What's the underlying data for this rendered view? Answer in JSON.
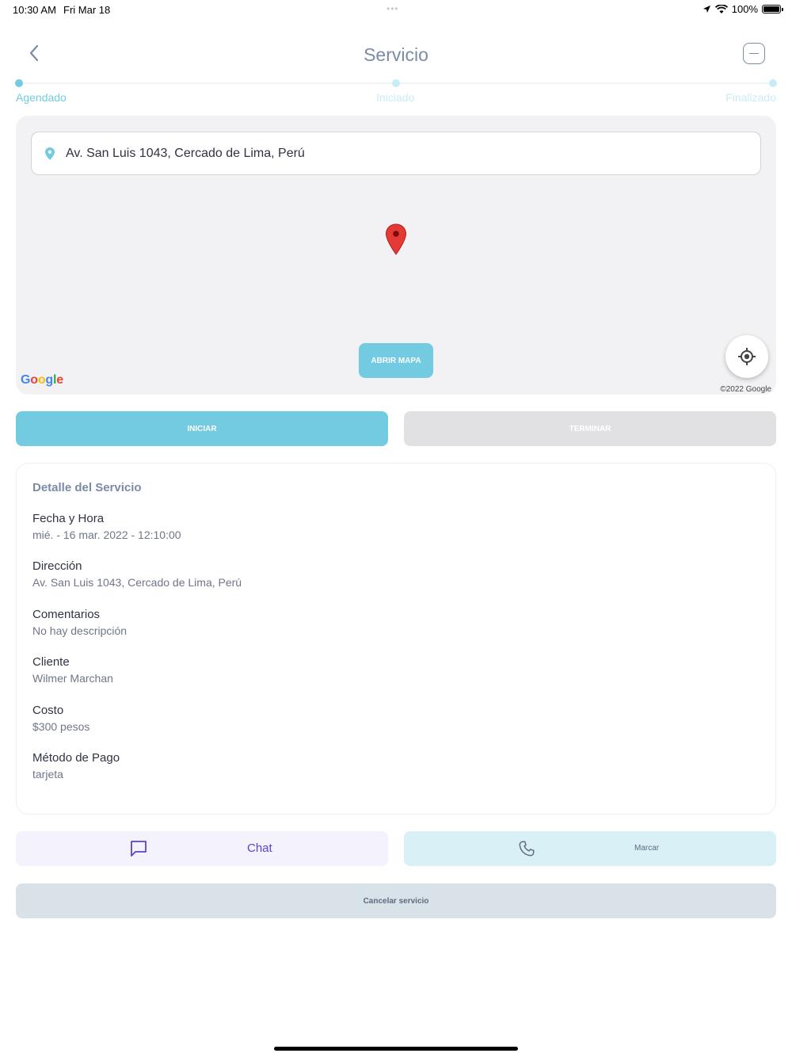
{
  "status_bar": {
    "time": "10:30 AM",
    "date": "Fri Mar 18",
    "battery": "100%"
  },
  "header": {
    "title": "Servicio",
    "back_icon": "chevron-left-icon",
    "menu_icon": "minus-square-icon"
  },
  "stepper": {
    "steps": [
      {
        "label": "Agendado",
        "active": true
      },
      {
        "label": "Iniciado",
        "active": false
      },
      {
        "label": "Finalizado",
        "active": false
      }
    ],
    "active_color": "#72cbe0",
    "inactive_color": "#c9ecf4"
  },
  "map": {
    "address": "Av. San Luis 1043, Cercado de Lima, Perú",
    "open_map_label": "ABRIR MAPA",
    "google_label": "Google",
    "copyright": "©2022 Google"
  },
  "actions": {
    "start_label": "INICIAR",
    "finish_label": "TERMINAR"
  },
  "details": {
    "title": "Detalle del Servicio",
    "items": [
      {
        "label": "Fecha y Hora",
        "value": "mié. - 16 mar. 2022 - 12:10:00"
      },
      {
        "label": "Dirección",
        "value": "Av. San Luis 1043, Cercado de Lima, Perú"
      },
      {
        "label": "Comentarios",
        "value": "No hay descripción"
      },
      {
        "label": "Cliente",
        "value": "Wilmer Marchan"
      },
      {
        "label": "Costo",
        "value": "$300 pesos"
      },
      {
        "label": "Método de Pago",
        "value": "tarjeta"
      }
    ]
  },
  "footer": {
    "chat_label": "Chat",
    "call_label": "Marcar",
    "cancel_label": "Cancelar servicio"
  },
  "colors": {
    "accent": "#72cbe0",
    "title": "#7b8ba7",
    "chat": "#5546cf"
  }
}
